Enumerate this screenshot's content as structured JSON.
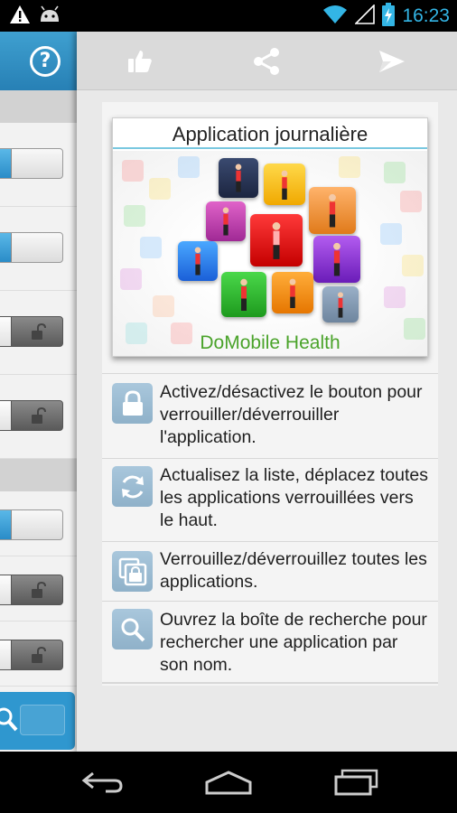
{
  "status_bar": {
    "time": "16:23",
    "left_icons": [
      "warning-icon",
      "android-icon"
    ],
    "right_icons": [
      "wifi-icon",
      "signal-icon",
      "battery-charging-icon"
    ],
    "time_color": "#33b5e5"
  },
  "left_panel": {
    "header_icon": "help-icon",
    "accent": "#2f97cf",
    "rows": [
      {
        "toggle": "on"
      },
      {
        "toggle": "on"
      },
      {
        "toggle": "locked"
      },
      {
        "toggle": "locked"
      },
      {
        "toggle": "on"
      },
      {
        "toggle": "locked"
      },
      {
        "toggle": "locked"
      }
    ],
    "bottom_icon": "search-icon"
  },
  "toolbar": {
    "icons": [
      "thumbs-up-icon",
      "share-icon",
      "send-icon"
    ]
  },
  "banner": {
    "title": "Application journalière",
    "caption": "DoMobile Health"
  },
  "help_items": [
    {
      "icon": "lock-icon",
      "text": "Activez/désactivez le bouton pour verrouiller/déverrouiller l'application."
    },
    {
      "icon": "refresh-icon",
      "text": "Actualisez la liste, déplacez toutes les applications verrouillées vers le haut."
    },
    {
      "icon": "lock-all-icon",
      "text": "Verrouillez/déverrouillez toutes les applications."
    },
    {
      "icon": "search-icon",
      "text": "Ouvrez la boîte de recherche pour rechercher une application par son nom."
    }
  ],
  "nav_bar": {
    "icons": [
      "back-icon",
      "home-icon",
      "recent-apps-icon"
    ]
  }
}
